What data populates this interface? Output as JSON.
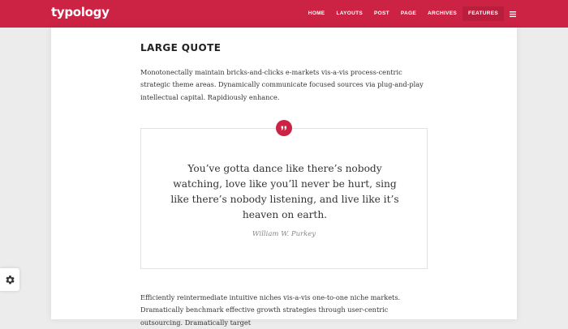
{
  "brand": {
    "logo": "typology",
    "accent": "#cc2244"
  },
  "nav": {
    "items": [
      {
        "label": "HOME"
      },
      {
        "label": "LAYOUTS"
      },
      {
        "label": "POST"
      },
      {
        "label": "PAGE"
      },
      {
        "label": "ARCHIVES"
      },
      {
        "label": "FEATURES",
        "active": true
      }
    ],
    "menu_icon": "hamburger-icon"
  },
  "article": {
    "title": "LARGE QUOTE",
    "intro": "Monotonectally maintain bricks-and-clicks e-markets vis-a-vis process-centric strategic theme areas. Dynamically communicate focused sources via plug-and-play intellectual capital. Rapidiously enhance.",
    "quote": {
      "icon": "quote-icon",
      "text": "You’ve gotta dance like there’s nobody watching, love like you’ll never be hurt, sing like there’s nobody listening, and live like it’s heaven on earth.",
      "author": "William W. Purkey"
    },
    "outro": "Efficiently reintermediate intuitive niches vis-a-vis one-to-one niche markets. Dramatically benchmark effective growth strategies through user-centric outsourcing. Dramatically target"
  },
  "settings": {
    "icon": "gear-icon"
  }
}
